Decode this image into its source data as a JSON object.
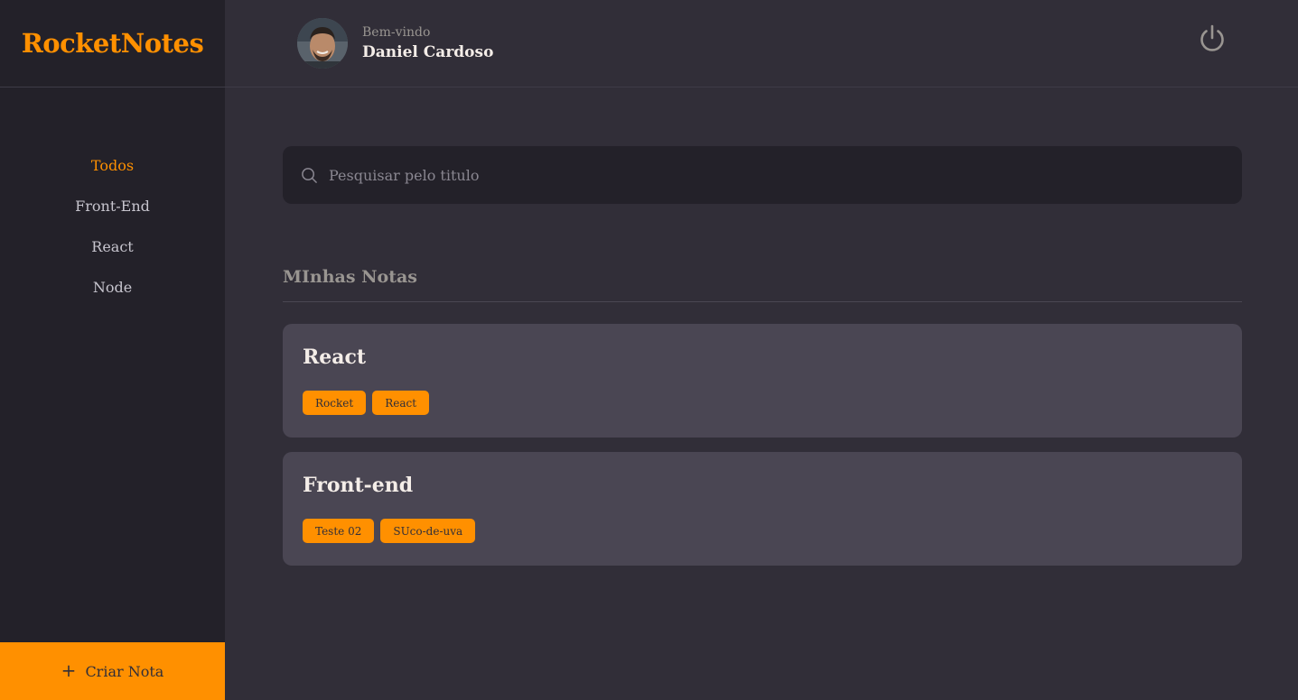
{
  "brand": {
    "name": "RocketNotes",
    "accent": "#FF9000"
  },
  "header": {
    "welcome": "Bem-vindo",
    "username": "Daniel Cardoso",
    "avatar_icon": "user-avatar",
    "logout_icon": "power-icon"
  },
  "sidebar": {
    "items": [
      {
        "label": "Todos",
        "active": true
      },
      {
        "label": "Front-End",
        "active": false
      },
      {
        "label": "React",
        "active": false
      },
      {
        "label": "Node",
        "active": false
      }
    ],
    "new_note_icon": "plus-icon",
    "new_note_label": "Criar Nota"
  },
  "search": {
    "placeholder": "Pesquisar pelo titulo",
    "value": ""
  },
  "section": {
    "title": "MInhas Notas"
  },
  "notes": [
    {
      "title": "React",
      "tags": [
        "Rocket",
        "React"
      ]
    },
    {
      "title": "Front-end",
      "tags": [
        "Teste 02",
        "SUco-de-uva"
      ]
    }
  ]
}
